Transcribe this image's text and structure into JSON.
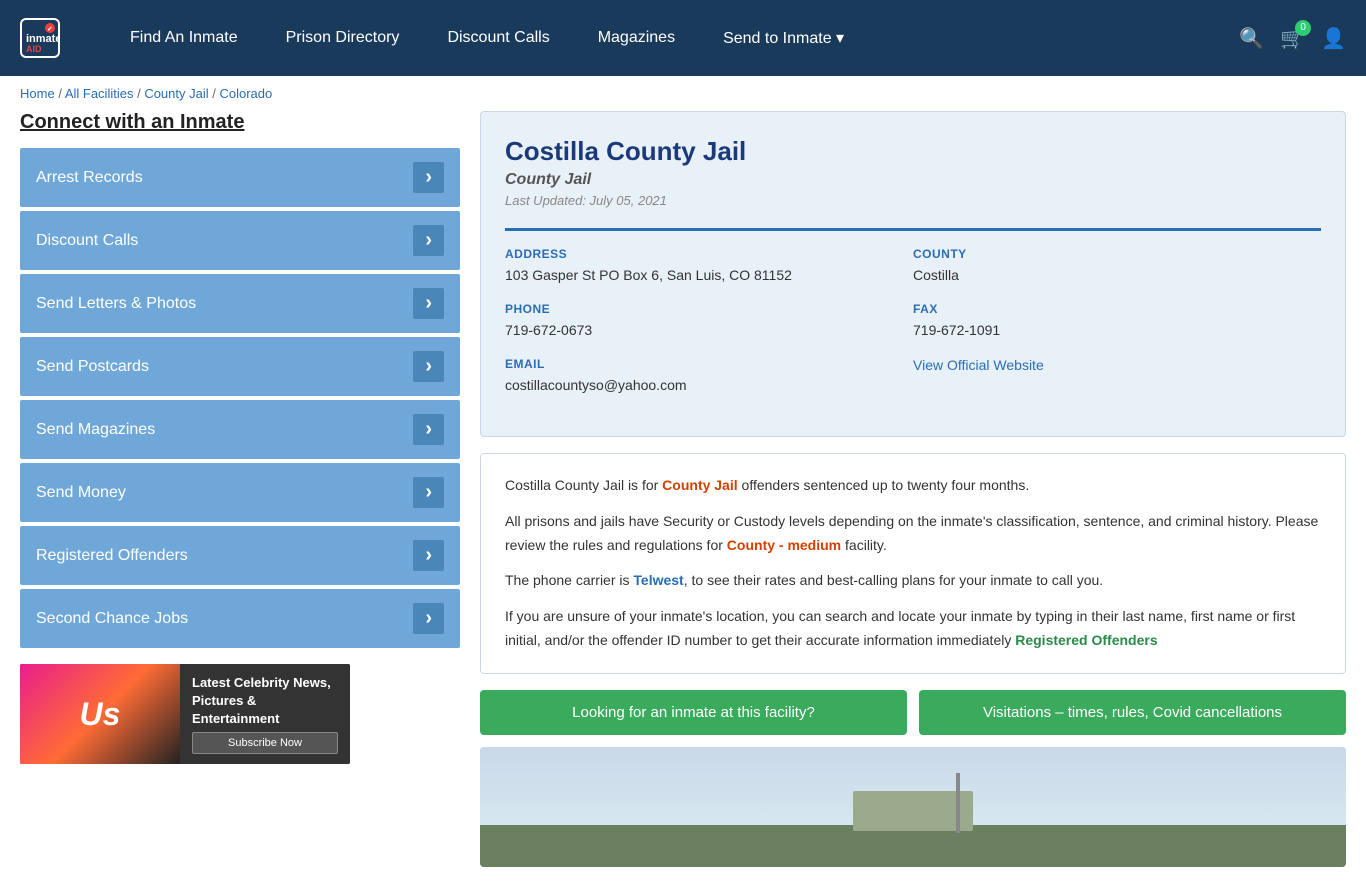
{
  "header": {
    "logo": "inmateAID",
    "nav": {
      "find_inmate": "Find An Inmate",
      "prison_directory": "Prison Directory",
      "discount_calls": "Discount Calls",
      "magazines": "Magazines",
      "send_to_inmate": "Send to Inmate ▾"
    },
    "cart_count": "0"
  },
  "breadcrumb": {
    "home": "Home",
    "all_facilities": "All Facilities",
    "county_jail": "County Jail",
    "colorado": "Colorado",
    "separator": "/"
  },
  "sidebar": {
    "title": "Connect with an Inmate",
    "items": [
      {
        "label": "Arrest Records"
      },
      {
        "label": "Discount Calls"
      },
      {
        "label": "Send Letters & Photos"
      },
      {
        "label": "Send Postcards"
      },
      {
        "label": "Send Magazines"
      },
      {
        "label": "Send Money"
      },
      {
        "label": "Registered Offenders"
      },
      {
        "label": "Second Chance Jobs"
      }
    ],
    "ad": {
      "brand": "Us",
      "headline": "Latest Celebrity News, Pictures & Entertainment",
      "subscribe": "Subscribe Now"
    }
  },
  "facility": {
    "name": "Costilla County Jail",
    "type": "County Jail",
    "last_updated": "Last Updated: July 05, 2021",
    "address_label": "ADDRESS",
    "address_value": "103 Gasper St PO Box 6, San Luis, CO 81152",
    "county_label": "COUNTY",
    "county_value": "Costilla",
    "phone_label": "PHONE",
    "phone_value": "719-672-0673",
    "fax_label": "FAX",
    "fax_value": "719-672-1091",
    "email_label": "EMAIL",
    "email_value": "costillacountyso@yahoo.com",
    "website_label": "View Official Website",
    "description1": "Costilla County Jail is for County Jail offenders sentenced up to twenty four months.",
    "description2": "All prisons and jails have Security or Custody levels depending on the inmate's classification, sentence, and criminal history. Please review the rules and regulations for County - medium facility.",
    "description3": "The phone carrier is Telwest, to see their rates and best-calling plans for your inmate to call you.",
    "description4": "If you are unsure of your inmate's location, you can search and locate your inmate by typing in their last name, first name or first initial, and/or the offender ID number to get their accurate information immediately Registered Offenders",
    "btn1": "Looking for an inmate at this facility?",
    "btn2": "Visitations – times, rules, Covid cancellations"
  }
}
